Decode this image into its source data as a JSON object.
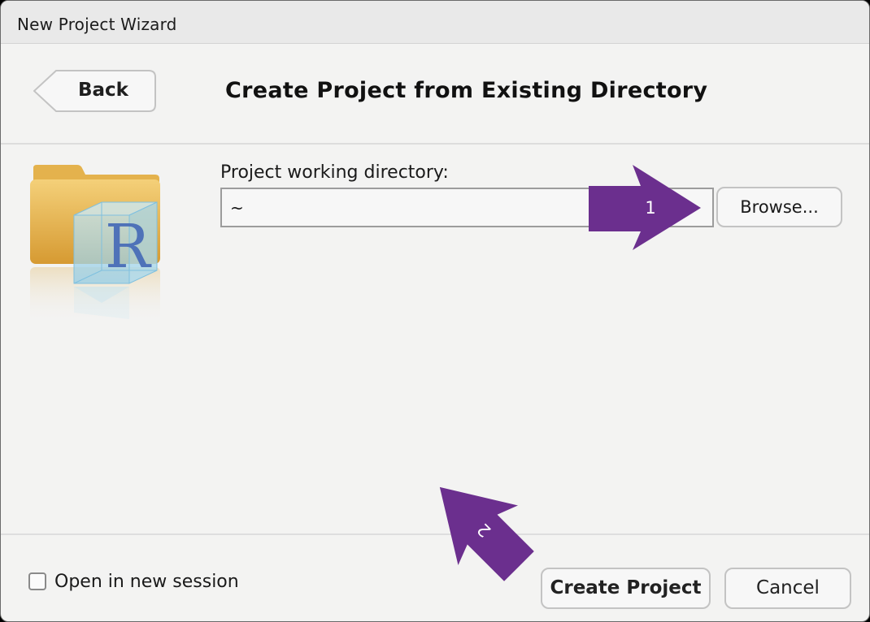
{
  "window": {
    "title": "New Project Wizard"
  },
  "header": {
    "back_label": "Back",
    "page_title": "Create Project from Existing Directory"
  },
  "main": {
    "directory_label": "Project working directory:",
    "directory_value": "~",
    "browse_label": "Browse..."
  },
  "footer": {
    "open_new_session_label": "Open in new session",
    "open_new_session_checked": false,
    "create_label": "Create Project",
    "cancel_label": "Cancel"
  },
  "annotations": {
    "arrow_1_label": "1",
    "arrow_2_label": "2",
    "arrow_color": "#6b2f8e"
  },
  "icons": {
    "project_icon": "r-folder-icon"
  }
}
